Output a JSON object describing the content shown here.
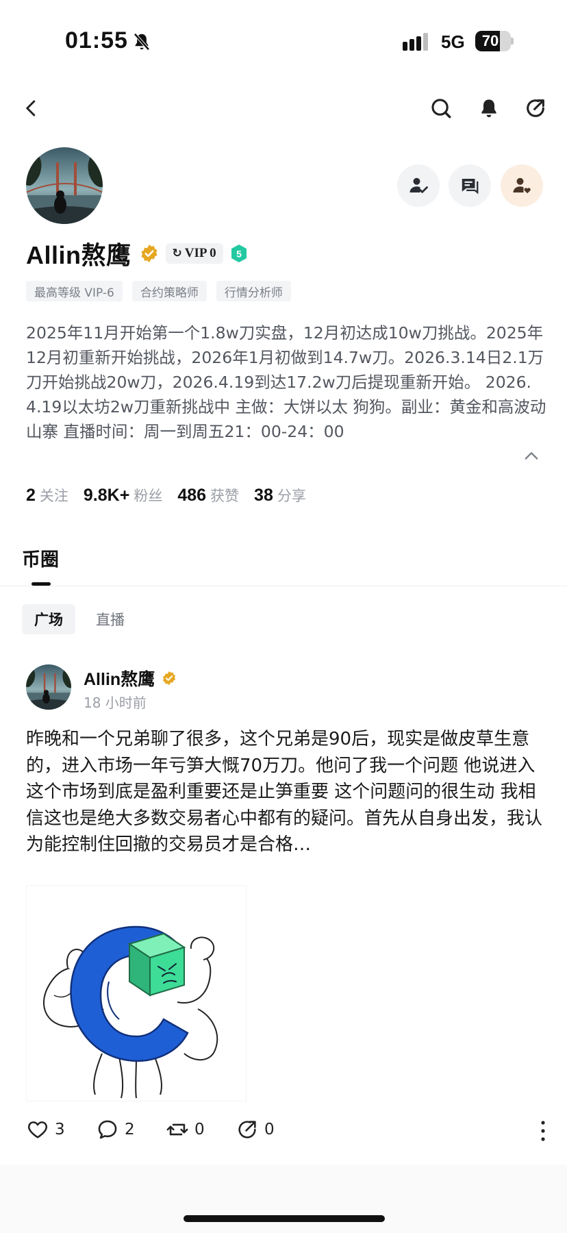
{
  "status_bar": {
    "time": "01:55",
    "network": "5G",
    "battery": "70",
    "battery_level": 0.7
  },
  "icons": {
    "back": "chevron-left-icon",
    "search": "search-icon",
    "notifications": "bell-icon",
    "share": "share-icon",
    "follow": "user-check-icon",
    "message": "chat-icon",
    "tip": "user-heart-icon"
  },
  "profile": {
    "name": "Allin熬鹰",
    "vip_label": "VIP 0",
    "level": "5",
    "tags": [
      "最高等级 VIP-6",
      "合约策略师",
      "行情分析师"
    ],
    "bio": "2025年11月开始第一个1.8w刀实盘，12月初达成10w刀挑战。2025年12月初重新开始挑战，2026年1月初做到14.7w刀。2026.3.14日2.1万刀开始挑战20w刀，2026.4.19到达17.2w刀后提现重新开始。 2026.4.19以太坊2w刀重新挑战中   主做：大饼以太 狗狗。副业：黄金和高波动山寨            直播时间：周一到周五21：00-24：00",
    "stats": [
      {
        "value": "2",
        "label": "关注"
      },
      {
        "value": "9.8K+",
        "label": "粉丝"
      },
      {
        "value": "486",
        "label": "获赞"
      },
      {
        "value": "38",
        "label": "分享"
      }
    ]
  },
  "section": {
    "title": "币圈",
    "subtabs": [
      "广场",
      "直播"
    ]
  },
  "post": {
    "author": "Allin熬鹰",
    "time": "18 小时前",
    "text": "昨晚和一个兄弟聊了很多，这个兄弟是90后，现实是做皮草生意的，进入市场一年亏笋大慨70万刀。他问了我一个问题 他说进入这个市场到底是盈利重要还是止笋重要 这个问题问的很生动 我相信这也是绝大多数交易者心中都有的疑问。首先从自身出发，我认为能控制住回撤的交易员才是合格…",
    "likes": "3",
    "comments": "2",
    "reposts": "0",
    "shares": "0"
  },
  "colors": {
    "accent_gold": "#e6a822",
    "level_green": "#23c9a1",
    "brand_blue": "#1f5fd6",
    "cube_green": "#3ddc97"
  }
}
